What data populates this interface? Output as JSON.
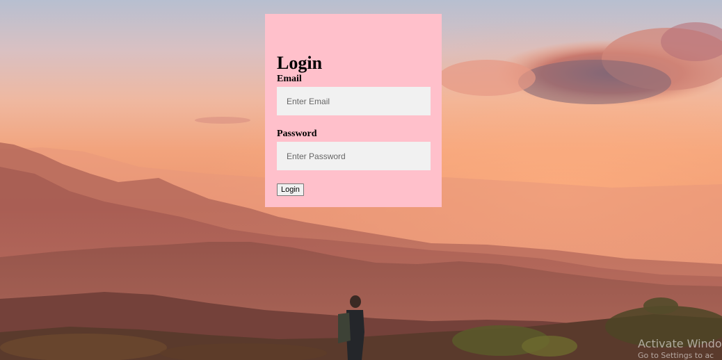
{
  "login": {
    "title": "Login",
    "email_label": "Email",
    "email_placeholder": "Enter Email",
    "email_value": "",
    "password_label": "Password",
    "password_placeholder": "Enter Password",
    "password_value": "",
    "submit_label": "Login"
  },
  "watermark": {
    "line1": "Activate Windo",
    "line2": "Go to Settings to ac"
  },
  "colors": {
    "card_background": "#ffc0cb",
    "input_background": "#f1f1f1",
    "sky_top": "#bcc2d0",
    "sky_horizon": "#f0a277",
    "mountains": "#8a4e44"
  },
  "background": {
    "scene": "sunset-mountain-landscape"
  }
}
